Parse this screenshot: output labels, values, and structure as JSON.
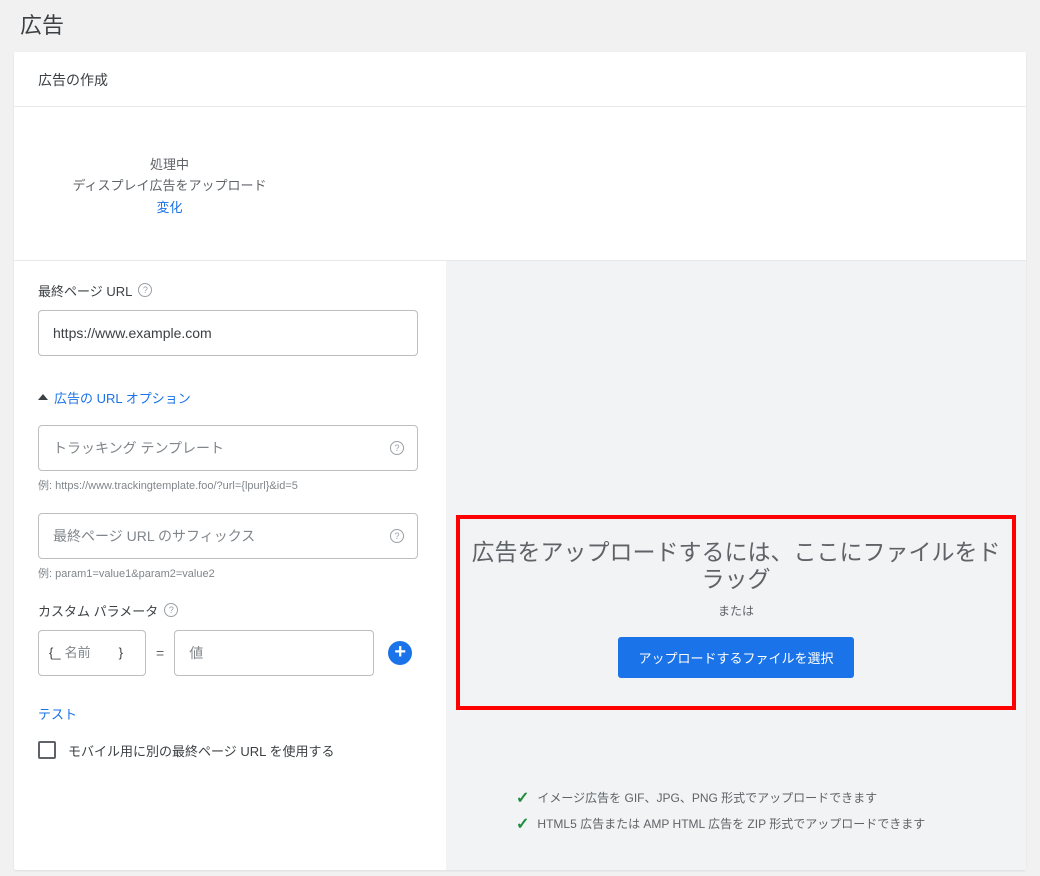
{
  "header": {
    "title": "広告"
  },
  "card": {
    "title": "広告の作成",
    "status": {
      "processing": "処理中",
      "subtitle": "ディスプレイ広告をアップロード",
      "change": "変化"
    }
  },
  "form": {
    "finalUrl": {
      "label": "最終ページ URL",
      "value": "https://www.example.com"
    },
    "urlOptions": {
      "toggleLabel": "広告の URL オプション",
      "trackingTemplate": {
        "placeholder": "トラッキング テンプレート",
        "example": "例: https://www.trackingtemplate.foo/?url={lpurl}&id=5"
      },
      "finalUrlSuffix": {
        "placeholder": "最終ページ URL のサフィックス",
        "example": "例: param1=value1&param2=value2"
      },
      "customParams": {
        "label": "カスタム パラメータ",
        "namePrefix": "{_",
        "nameSuffix": "}",
        "namePlaceholder": "名前",
        "equals": "=",
        "valuePlaceholder": "値"
      },
      "testLink": "テスト",
      "mobileCheckbox": "モバイル用に別の最終ページ URL を使用する"
    }
  },
  "uploadPanel": {
    "dragTitle": "広告をアップロードするには、ここにファイルをドラッグ",
    "or": "または",
    "button": "アップロードするファイルを選択",
    "tips": [
      "イメージ広告を GIF、JPG、PNG 形式でアップロードできます",
      "HTML5 広告または AMP HTML 広告を ZIP 形式でアップロードできます"
    ]
  }
}
